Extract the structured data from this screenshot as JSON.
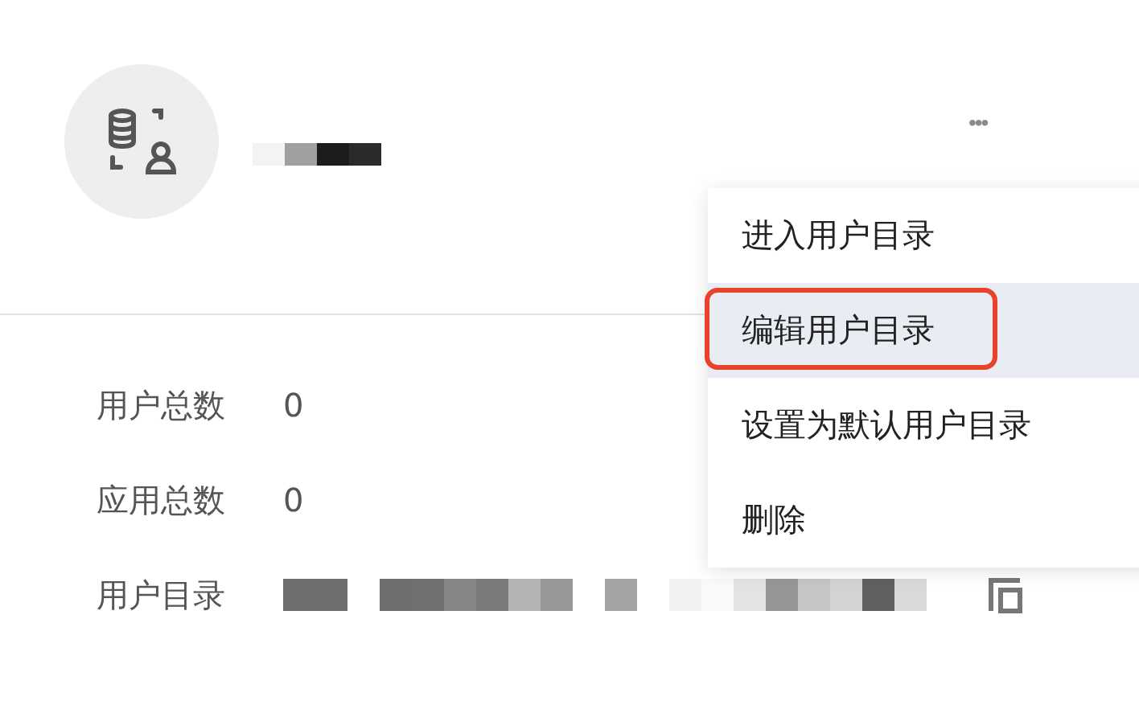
{
  "header": {
    "more_button": "•••"
  },
  "details": [
    {
      "label": "用户总数",
      "value": "0",
      "kind": "text"
    },
    {
      "label": "应用总数",
      "value": "0",
      "kind": "text"
    },
    {
      "label": "用户目录",
      "kind": "redacted"
    }
  ],
  "menu": {
    "items": [
      {
        "label": "进入用户目录",
        "selected": false,
        "outlined": false
      },
      {
        "label": "编辑用户目录",
        "selected": true,
        "outlined": true
      },
      {
        "label": "设置为默认用户目录",
        "selected": false,
        "outlined": false
      },
      {
        "label": "删除",
        "selected": false,
        "outlined": false
      }
    ]
  }
}
